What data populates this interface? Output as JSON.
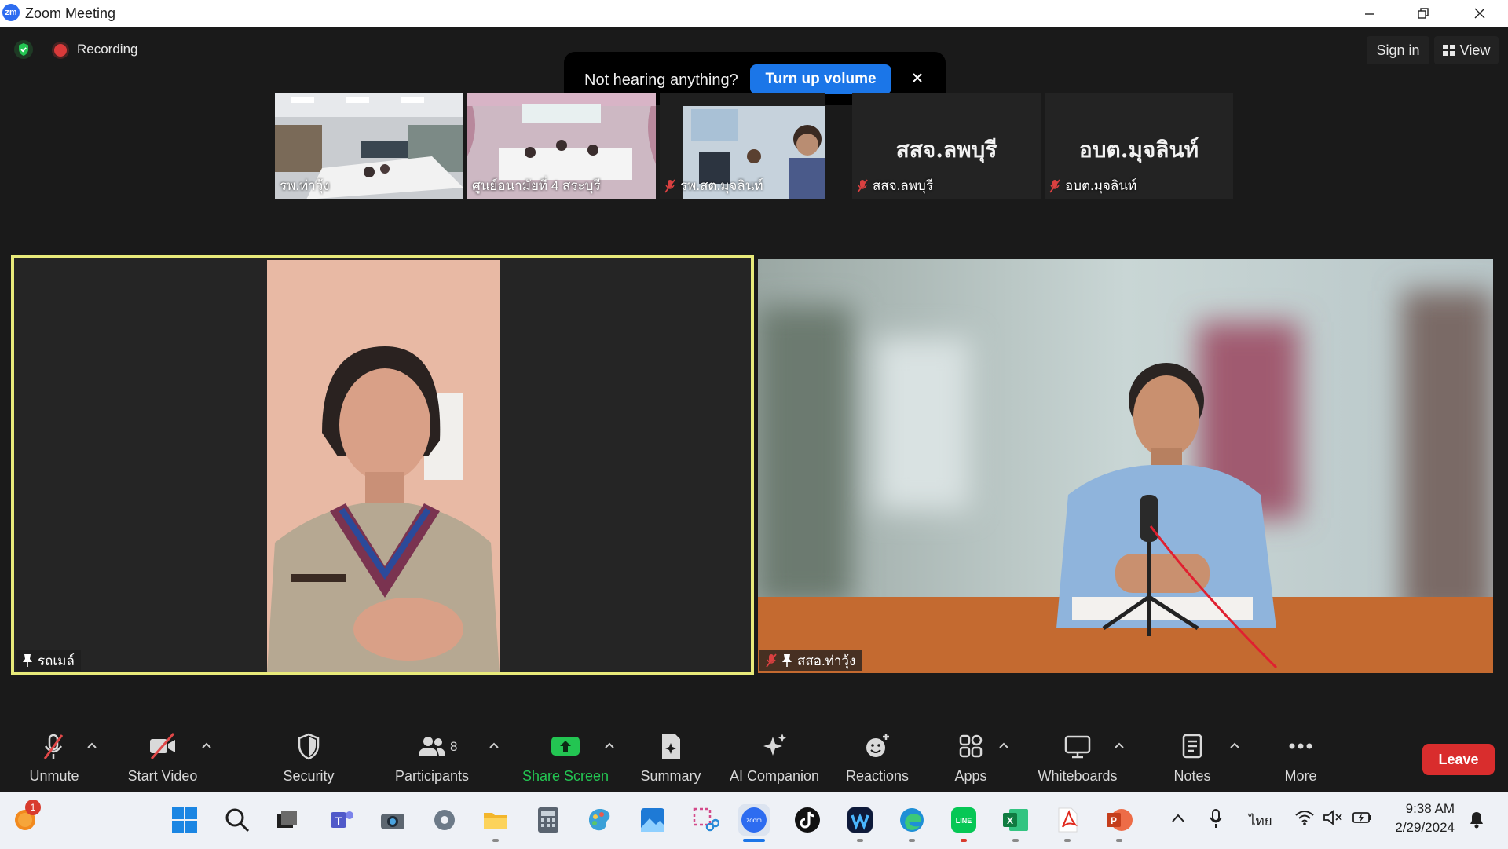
{
  "window": {
    "title": "Zoom Meeting",
    "logo_text": "zm"
  },
  "status": {
    "recording_label": "Recording"
  },
  "header_right": {
    "sign_in_label": "Sign in",
    "view_label": "View"
  },
  "notification": {
    "text": "Not hearing anything?",
    "button_label": "Turn up volume"
  },
  "thumbnails": [
    {
      "name": "รพ.ท่าวุ้ง",
      "muted": false,
      "video": true
    },
    {
      "name": "ศูนย์อนามัยที่ 4 สระบุรี",
      "muted": false,
      "video": true
    },
    {
      "name": "รพ.สต.มุจลินท์",
      "muted": true,
      "video": true
    },
    {
      "name": "สสจ.ลพบุรี",
      "display_name": "สสจ.ลพบุรี",
      "muted": true,
      "video": false
    },
    {
      "name": "อบต.มุจลินท์",
      "display_name": "อบต.มุจลินท์",
      "muted": true,
      "video": false
    }
  ],
  "main_tiles": {
    "left": {
      "name": "รถเมล์",
      "pinned": true,
      "active_speaker": true
    },
    "right": {
      "name": "สสอ.ท่าวุ้ง",
      "pinned": true,
      "muted": true
    }
  },
  "toolbar": {
    "unmute_label": "Unmute",
    "start_video_label": "Start Video",
    "security_label": "Security",
    "participants_label": "Participants",
    "participants_count": "8",
    "share_screen_label": "Share Screen",
    "summary_label": "Summary",
    "ai_companion_label": "AI Companion",
    "reactions_label": "Reactions",
    "apps_label": "Apps",
    "whiteboards_label": "Whiteboards",
    "notes_label": "Notes",
    "more_label": "More",
    "leave_label": "Leave",
    "share_color": "#23c552"
  },
  "taskbar": {
    "notification_badge": "1",
    "language": "ไทย",
    "time": "9:38 AM",
    "date": "2/29/2024",
    "apps": [
      "start-icon",
      "search-icon",
      "task-view-icon",
      "teams-icon",
      "camera-icon",
      "settings-icon",
      "file-explorer-icon",
      "calculator-icon",
      "paint-icon",
      "photos-icon",
      "snipping-tool-icon",
      "zoom-icon",
      "tiktok-icon",
      "webex-icon",
      "edge-icon",
      "line-icon",
      "excel-icon",
      "acrobat-icon",
      "powerpoint-icon"
    ]
  }
}
